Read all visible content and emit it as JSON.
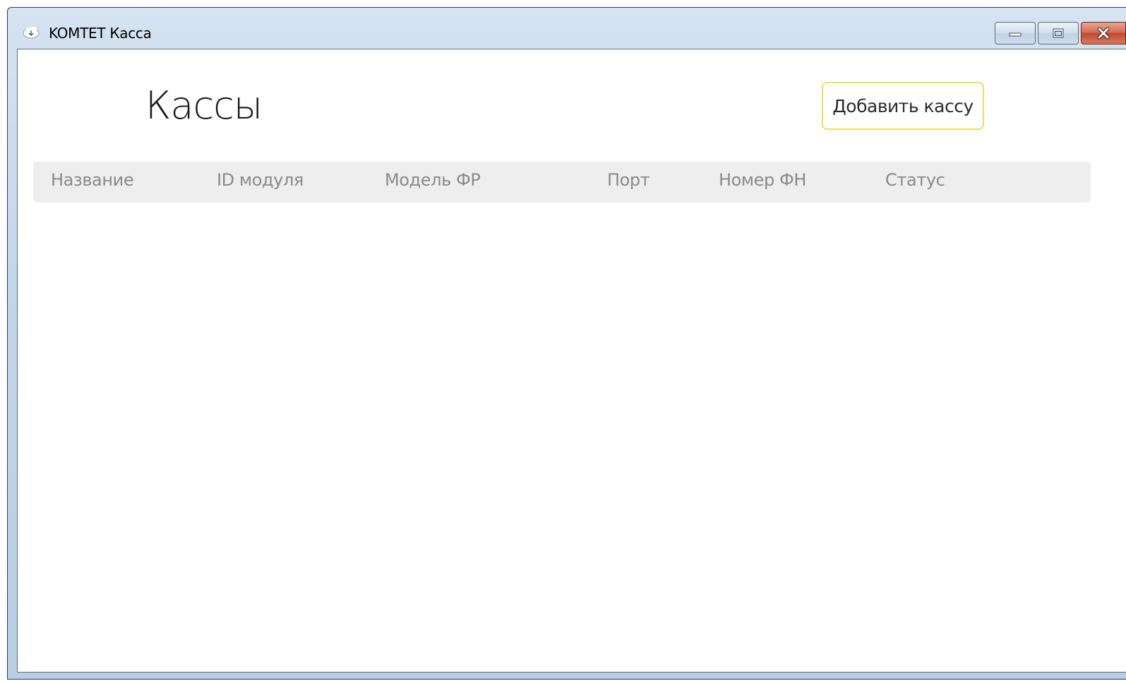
{
  "window": {
    "title": "KOMTET Касса",
    "icon": "cloud-icon",
    "controls": {
      "minimize": "minimize-icon",
      "maximize": "maximize-icon",
      "close": "close-icon"
    }
  },
  "page": {
    "title": "Кассы",
    "add_button_label": "Добавить кассу"
  },
  "table": {
    "columns": [
      "Название",
      "ID модуля",
      "Модель ФР",
      "Порт",
      "Номер ФН",
      "Статус"
    ],
    "rows": []
  },
  "colors": {
    "accent_border": "#f4dc5a",
    "header_bg": "#eeeeee",
    "header_text": "#8a8a8a"
  }
}
